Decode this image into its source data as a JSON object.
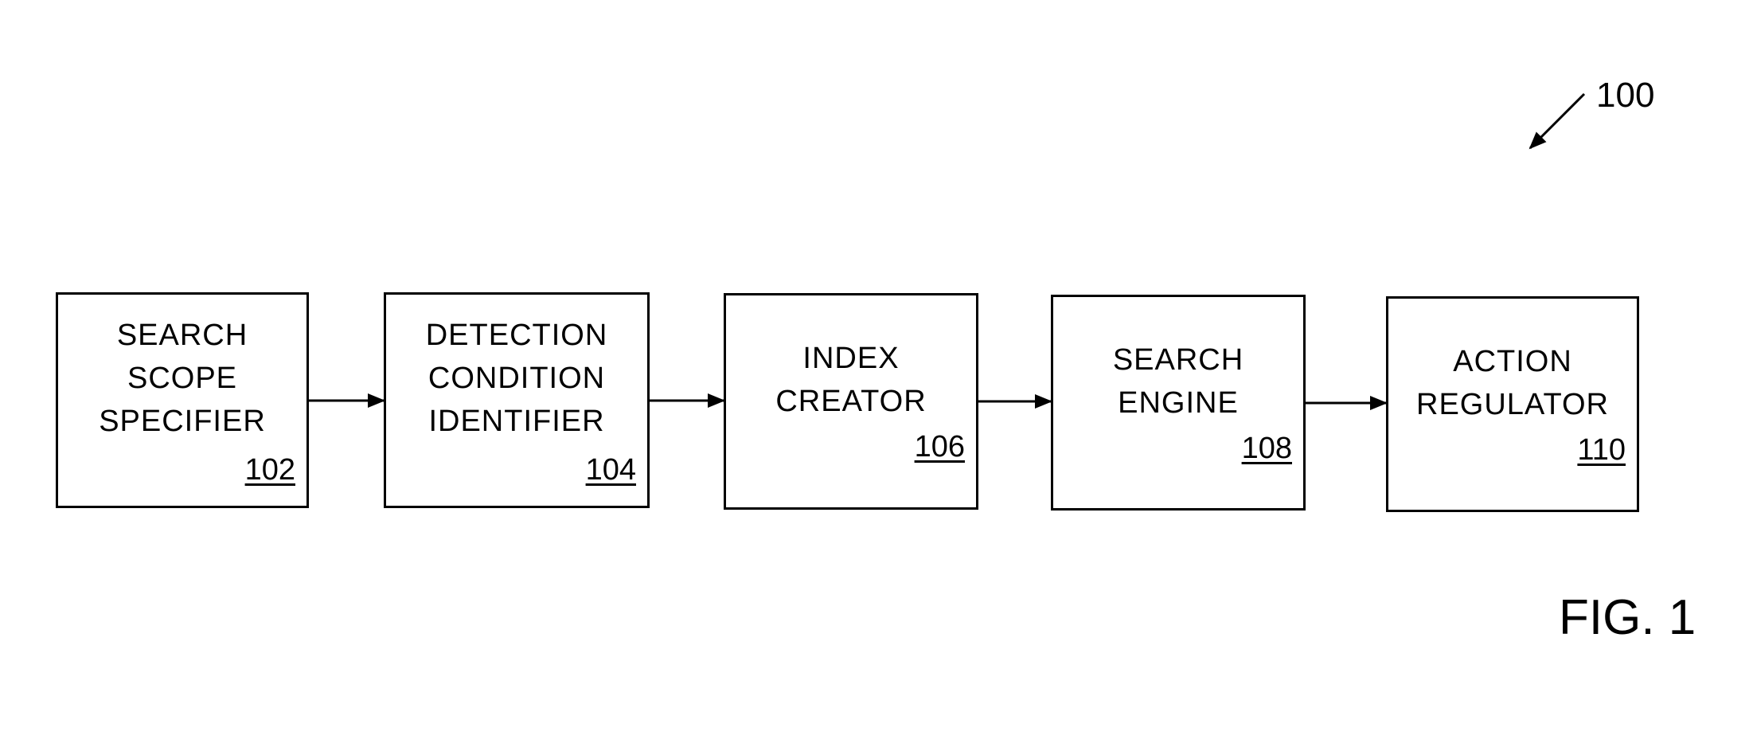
{
  "figure": {
    "ref_number": "100",
    "title": "FIG. 1"
  },
  "blocks": [
    {
      "lines": [
        "SEARCH",
        "SCOPE",
        "SPECIFIER"
      ],
      "ref": "102"
    },
    {
      "lines": [
        "DETECTION",
        "CONDITION",
        "IDENTIFIER"
      ],
      "ref": "104"
    },
    {
      "lines": [
        "INDEX",
        "CREATOR"
      ],
      "ref": "106"
    },
    {
      "lines": [
        "SEARCH",
        "ENGINE"
      ],
      "ref": "108"
    },
    {
      "lines": [
        "ACTION",
        "REGULATOR"
      ],
      "ref": "110"
    }
  ],
  "connections": [
    {
      "from": "102",
      "to": "104"
    },
    {
      "from": "104",
      "to": "106"
    },
    {
      "from": "106",
      "to": "108"
    },
    {
      "from": "108",
      "to": "110"
    }
  ]
}
